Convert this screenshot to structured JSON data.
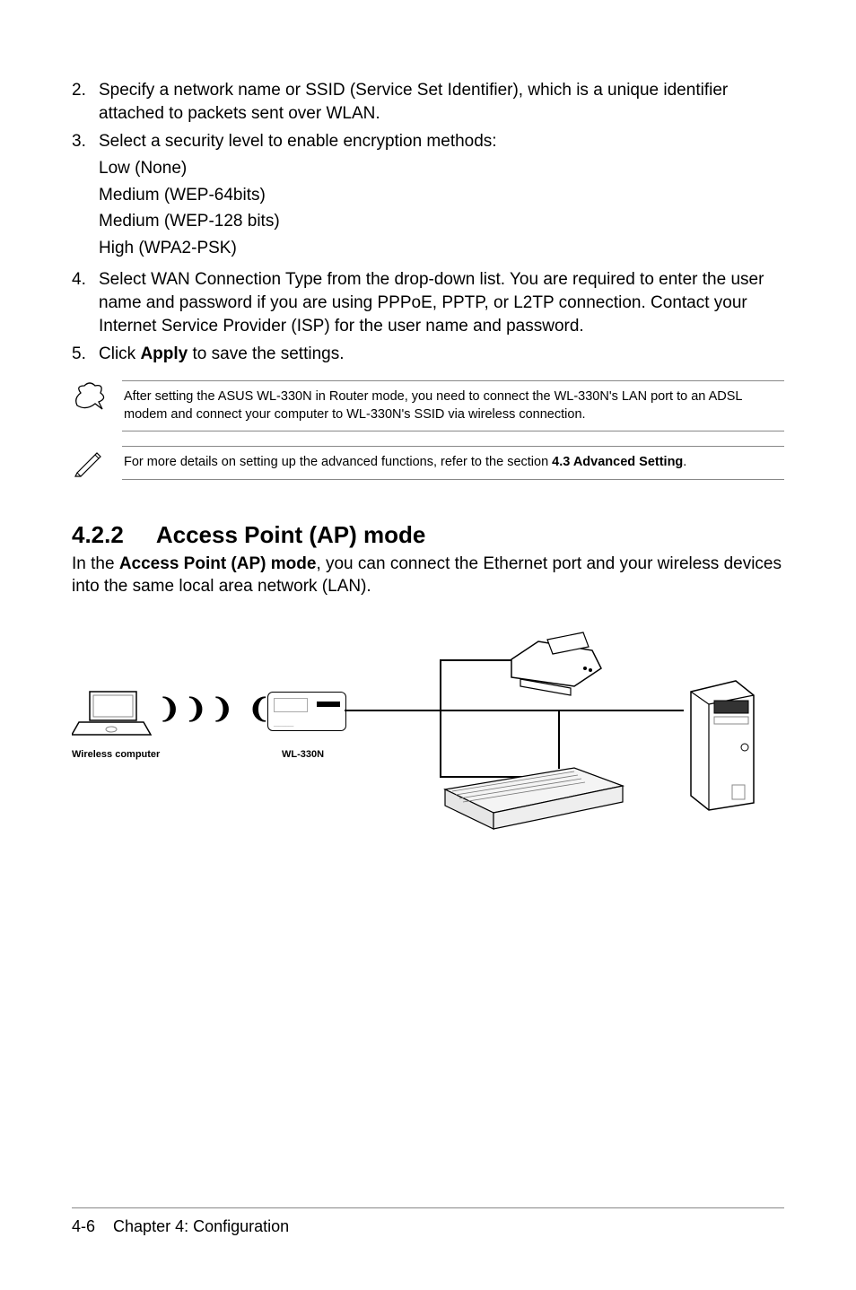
{
  "list": {
    "item2": {
      "num": "2.",
      "text": "Specify a network name or SSID (Service Set Identifier), which is a unique identifier attached to packets sent over WLAN."
    },
    "item3": {
      "num": "3.",
      "text": "Select a security level to enable encryption methods:",
      "sub1": "Low (None)",
      "sub2": "Medium (WEP-64bits)",
      "sub3": "Medium (WEP-128 bits)",
      "sub4": "High (WPA2-PSK)"
    },
    "item4": {
      "num": "4.",
      "text": "Select WAN Connection Type from the drop-down list. You are required to enter the user name and password if you are using PPPoE, PPTP, or L2TP connection. Contact your Internet Service Provider (ISP) for the user name and password."
    },
    "item5": {
      "num": "5.",
      "text_prefix": "Click ",
      "bold": "Apply",
      "text_suffix": " to save the settings."
    }
  },
  "note1": "After setting the ASUS WL-330N in Router mode, you need to connect the WL-330N's LAN port to an ADSL modem and connect your computer to WL-330N's SSID via wireless connection.",
  "note2": {
    "prefix": "For more details on setting up the advanced functions, refer to the section ",
    "bold": "4.3 Advanced Setting",
    "suffix": "."
  },
  "section": {
    "num": "4.2.2",
    "title": "Access Point (AP) mode",
    "para_prefix": "In the ",
    "para_bold": "Access Point (AP) mode",
    "para_suffix": ", you can connect the Ethernet port and your wireless devices into the same local area network (LAN)."
  },
  "diagram": {
    "wireless_label": "Wireless computer",
    "device_label": "WL-330N"
  },
  "footer": {
    "page": "4-6",
    "chapter": "Chapter 4: Configuration"
  }
}
